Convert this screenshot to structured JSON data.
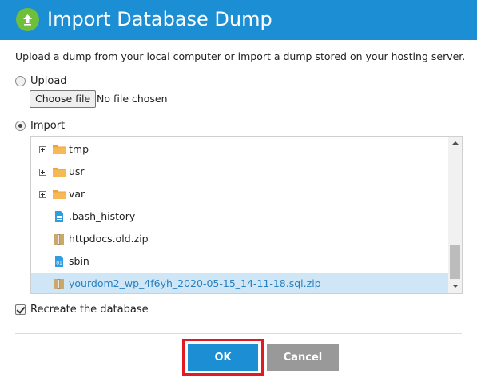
{
  "dialog": {
    "title": "Import Database Dump",
    "description": "Upload a dump from your local computer or import a dump stored on your hosting server."
  },
  "upload": {
    "label": "Upload",
    "selected": false,
    "choose_file_label": "Choose file",
    "no_file_text": "No file chosen"
  },
  "import": {
    "label": "Import",
    "selected": true
  },
  "file_tree": {
    "items": [
      {
        "name": "tmp",
        "type": "folder",
        "expandable": true,
        "selected": false
      },
      {
        "name": "usr",
        "type": "folder",
        "expandable": true,
        "selected": false
      },
      {
        "name": "var",
        "type": "folder",
        "expandable": true,
        "selected": false
      },
      {
        "name": ".bash_history",
        "type": "text-file",
        "expandable": false,
        "selected": false
      },
      {
        "name": "httpdocs.old.zip",
        "type": "archive-file",
        "expandable": false,
        "selected": false
      },
      {
        "name": "sbin",
        "type": "binary-file",
        "expandable": false,
        "selected": false
      },
      {
        "name": "yourdom2_wp_4f6yh_2020-05-15_14-11-18.sql.zip",
        "type": "archive-file",
        "expandable": false,
        "selected": true
      }
    ]
  },
  "recreate_db": {
    "label": "Recreate the database",
    "checked": true
  },
  "buttons": {
    "ok": "OK",
    "cancel": "Cancel"
  },
  "colors": {
    "title_bar": "#1c8fd4",
    "ok_button": "#1c8fd4",
    "cancel_button": "#999999",
    "highlight_outline": "#e01b24",
    "selected_row": "#cfe6f7"
  }
}
